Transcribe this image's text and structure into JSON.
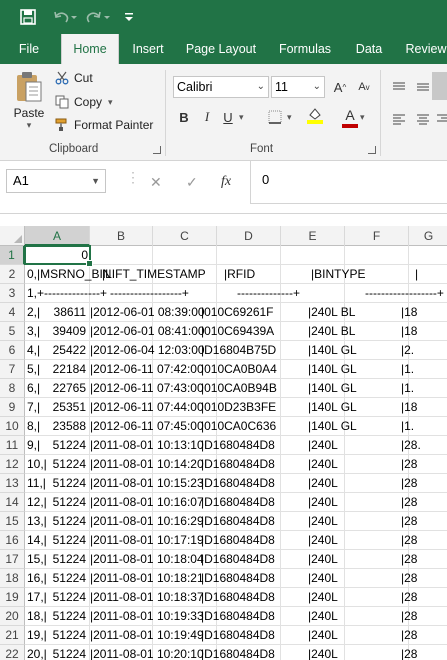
{
  "quick_access": {
    "save_icon": "save-icon",
    "undo_icon": "undo-icon",
    "redo_icon": "redo-icon",
    "customize_icon": "customize-icon"
  },
  "tabs": [
    "File",
    "Home",
    "Insert",
    "Page Layout",
    "Formulas",
    "Data",
    "Review"
  ],
  "active_tab": "Home",
  "clipboard": {
    "paste": "Paste",
    "cut": "Cut",
    "copy": "Copy",
    "format_painter": "Format Painter",
    "label": "Clipboard"
  },
  "font": {
    "family": "Calibri",
    "size": "11",
    "bold": "B",
    "italic": "I",
    "underline": "U",
    "label": "Font"
  },
  "formula_bar": {
    "name_box": "A1",
    "fx": "fx",
    "value": "0"
  },
  "columns": [
    "A",
    "B",
    "C",
    "D",
    "E",
    "F",
    "G"
  ],
  "rows": [
    {
      "num": "1",
      "cells": [
        "0",
        "",
        "",
        "",
        "",
        "",
        ""
      ]
    },
    {
      "num": "2",
      "cells": [
        "0,|MSRNO_BIN",
        "|LIFT_TIMESTAMP",
        "",
        "|RFID",
        "",
        "|BINTYPE",
        "|"
      ]
    },
    {
      "num": "3",
      "cells": [
        "1,+--------------+",
        "------------------+",
        "",
        "--------------+",
        "",
        "------------------+",
        ""
      ]
    },
    {
      "num": "4",
      "cells": [
        "2,|",
        "38611",
        "|2012-06-01 08:39:00",
        "|010C69261F",
        "",
        "|240L BL",
        "|18"
      ]
    },
    {
      "num": "5",
      "cells": [
        "3,|",
        "39409",
        "|2012-06-01 08:41:00",
        "|010C69439A",
        "",
        "|240L BL",
        "|18"
      ]
    },
    {
      "num": "6",
      "cells": [
        "4,|",
        "25422",
        "|2012-06-04 12:03:00",
        "|D16804B75D",
        "",
        "|140L GL",
        "|2."
      ]
    },
    {
      "num": "7",
      "cells": [
        "5,|",
        "22184",
        "|2012-06-11 07:42:00",
        "|010CA0B0A4",
        "",
        "|140L GL",
        "|1."
      ]
    },
    {
      "num": "8",
      "cells": [
        "6,|",
        "22765",
        "|2012-06-11 07:43:00",
        "|010CA0B94B",
        "",
        "|140L GL",
        "|1."
      ]
    },
    {
      "num": "9",
      "cells": [
        "7,|",
        "25351",
        "|2012-06-11 07:44:00",
        "|010D23B3FE",
        "",
        "|140L GL",
        "|18"
      ]
    },
    {
      "num": "10",
      "cells": [
        "8,|",
        "23588",
        "|2012-06-11 07:45:00",
        "|010CA0C636",
        "",
        "|140L GL",
        "|1."
      ]
    },
    {
      "num": "11",
      "cells": [
        "9,|",
        "51224",
        "|2011-08-01 10:13:10",
        "|D1680484D8",
        "",
        "|240L",
        "|28."
      ]
    },
    {
      "num": "12",
      "cells": [
        "10,|",
        "51224",
        "|2011-08-01 10:14:20",
        "|D1680484D8",
        "",
        "|240L",
        "|28"
      ]
    },
    {
      "num": "13",
      "cells": [
        "11,|",
        "51224",
        "|2011-08-01 10:15:23",
        "|D1680484D8",
        "",
        "|240L",
        "|28"
      ]
    },
    {
      "num": "14",
      "cells": [
        "12,|",
        "51224",
        "|2011-08-01 10:16:07",
        "|D1680484D8",
        "",
        "|240L",
        "|28"
      ]
    },
    {
      "num": "15",
      "cells": [
        "13,|",
        "51224",
        "|2011-08-01 10:16:29",
        "|D1680484D8",
        "",
        "|240L",
        "|28"
      ]
    },
    {
      "num": "16",
      "cells": [
        "14,|",
        "51224",
        "|2011-08-01 10:17:19",
        "|D1680484D8",
        "",
        "|240L",
        "|28"
      ]
    },
    {
      "num": "17",
      "cells": [
        "15,|",
        "51224",
        "|2011-08-01 10:18:04",
        "|D1680484D8",
        "",
        "|240L",
        "|28"
      ]
    },
    {
      "num": "18",
      "cells": [
        "16,|",
        "51224",
        "|2011-08-01 10:18:21",
        "|D1680484D8",
        "",
        "|240L",
        "|28"
      ]
    },
    {
      "num": "19",
      "cells": [
        "17,|",
        "51224",
        "|2011-08-01 10:18:37",
        "|D1680484D8",
        "",
        "|240L",
        "|28"
      ]
    },
    {
      "num": "20",
      "cells": [
        "18,|",
        "51224",
        "|2011-08-01 10:19:33",
        "|D1680484D8",
        "",
        "|240L",
        "|28"
      ]
    },
    {
      "num": "21",
      "cells": [
        "19,|",
        "51224",
        "|2011-08-01 10:19:49",
        "|D1680484D8",
        "",
        "|240L",
        "|28"
      ]
    },
    {
      "num": "22",
      "cells": [
        "20,|",
        "51224",
        "|2011-08-01 10:20:10",
        "|D1680484D8",
        "",
        "|240L",
        "|28"
      ]
    }
  ],
  "colors": {
    "accent": "#217346",
    "ribbon": "#f3f3f3",
    "font_color_bar": "#c00000",
    "highlight_bar": "#ffff00"
  }
}
